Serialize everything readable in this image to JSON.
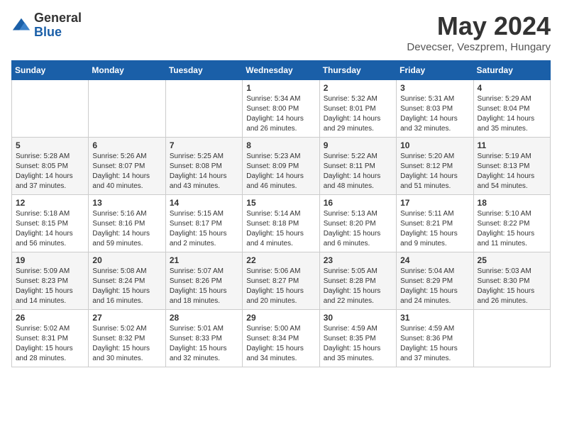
{
  "logo": {
    "general": "General",
    "blue": "Blue"
  },
  "title": "May 2024",
  "location": "Devecser, Veszprem, Hungary",
  "weekdays": [
    "Sunday",
    "Monday",
    "Tuesday",
    "Wednesday",
    "Thursday",
    "Friday",
    "Saturday"
  ],
  "weeks": [
    [
      {
        "day": "",
        "info": ""
      },
      {
        "day": "",
        "info": ""
      },
      {
        "day": "",
        "info": ""
      },
      {
        "day": "1",
        "info": "Sunrise: 5:34 AM\nSunset: 8:00 PM\nDaylight: 14 hours\nand 26 minutes."
      },
      {
        "day": "2",
        "info": "Sunrise: 5:32 AM\nSunset: 8:01 PM\nDaylight: 14 hours\nand 29 minutes."
      },
      {
        "day": "3",
        "info": "Sunrise: 5:31 AM\nSunset: 8:03 PM\nDaylight: 14 hours\nand 32 minutes."
      },
      {
        "day": "4",
        "info": "Sunrise: 5:29 AM\nSunset: 8:04 PM\nDaylight: 14 hours\nand 35 minutes."
      }
    ],
    [
      {
        "day": "5",
        "info": "Sunrise: 5:28 AM\nSunset: 8:05 PM\nDaylight: 14 hours\nand 37 minutes."
      },
      {
        "day": "6",
        "info": "Sunrise: 5:26 AM\nSunset: 8:07 PM\nDaylight: 14 hours\nand 40 minutes."
      },
      {
        "day": "7",
        "info": "Sunrise: 5:25 AM\nSunset: 8:08 PM\nDaylight: 14 hours\nand 43 minutes."
      },
      {
        "day": "8",
        "info": "Sunrise: 5:23 AM\nSunset: 8:09 PM\nDaylight: 14 hours\nand 46 minutes."
      },
      {
        "day": "9",
        "info": "Sunrise: 5:22 AM\nSunset: 8:11 PM\nDaylight: 14 hours\nand 48 minutes."
      },
      {
        "day": "10",
        "info": "Sunrise: 5:20 AM\nSunset: 8:12 PM\nDaylight: 14 hours\nand 51 minutes."
      },
      {
        "day": "11",
        "info": "Sunrise: 5:19 AM\nSunset: 8:13 PM\nDaylight: 14 hours\nand 54 minutes."
      }
    ],
    [
      {
        "day": "12",
        "info": "Sunrise: 5:18 AM\nSunset: 8:15 PM\nDaylight: 14 hours\nand 56 minutes."
      },
      {
        "day": "13",
        "info": "Sunrise: 5:16 AM\nSunset: 8:16 PM\nDaylight: 14 hours\nand 59 minutes."
      },
      {
        "day": "14",
        "info": "Sunrise: 5:15 AM\nSunset: 8:17 PM\nDaylight: 15 hours\nand 2 minutes."
      },
      {
        "day": "15",
        "info": "Sunrise: 5:14 AM\nSunset: 8:18 PM\nDaylight: 15 hours\nand 4 minutes."
      },
      {
        "day": "16",
        "info": "Sunrise: 5:13 AM\nSunset: 8:20 PM\nDaylight: 15 hours\nand 6 minutes."
      },
      {
        "day": "17",
        "info": "Sunrise: 5:11 AM\nSunset: 8:21 PM\nDaylight: 15 hours\nand 9 minutes."
      },
      {
        "day": "18",
        "info": "Sunrise: 5:10 AM\nSunset: 8:22 PM\nDaylight: 15 hours\nand 11 minutes."
      }
    ],
    [
      {
        "day": "19",
        "info": "Sunrise: 5:09 AM\nSunset: 8:23 PM\nDaylight: 15 hours\nand 14 minutes."
      },
      {
        "day": "20",
        "info": "Sunrise: 5:08 AM\nSunset: 8:24 PM\nDaylight: 15 hours\nand 16 minutes."
      },
      {
        "day": "21",
        "info": "Sunrise: 5:07 AM\nSunset: 8:26 PM\nDaylight: 15 hours\nand 18 minutes."
      },
      {
        "day": "22",
        "info": "Sunrise: 5:06 AM\nSunset: 8:27 PM\nDaylight: 15 hours\nand 20 minutes."
      },
      {
        "day": "23",
        "info": "Sunrise: 5:05 AM\nSunset: 8:28 PM\nDaylight: 15 hours\nand 22 minutes."
      },
      {
        "day": "24",
        "info": "Sunrise: 5:04 AM\nSunset: 8:29 PM\nDaylight: 15 hours\nand 24 minutes."
      },
      {
        "day": "25",
        "info": "Sunrise: 5:03 AM\nSunset: 8:30 PM\nDaylight: 15 hours\nand 26 minutes."
      }
    ],
    [
      {
        "day": "26",
        "info": "Sunrise: 5:02 AM\nSunset: 8:31 PM\nDaylight: 15 hours\nand 28 minutes."
      },
      {
        "day": "27",
        "info": "Sunrise: 5:02 AM\nSunset: 8:32 PM\nDaylight: 15 hours\nand 30 minutes."
      },
      {
        "day": "28",
        "info": "Sunrise: 5:01 AM\nSunset: 8:33 PM\nDaylight: 15 hours\nand 32 minutes."
      },
      {
        "day": "29",
        "info": "Sunrise: 5:00 AM\nSunset: 8:34 PM\nDaylight: 15 hours\nand 34 minutes."
      },
      {
        "day": "30",
        "info": "Sunrise: 4:59 AM\nSunset: 8:35 PM\nDaylight: 15 hours\nand 35 minutes."
      },
      {
        "day": "31",
        "info": "Sunrise: 4:59 AM\nSunset: 8:36 PM\nDaylight: 15 hours\nand 37 minutes."
      },
      {
        "day": "",
        "info": ""
      }
    ]
  ]
}
